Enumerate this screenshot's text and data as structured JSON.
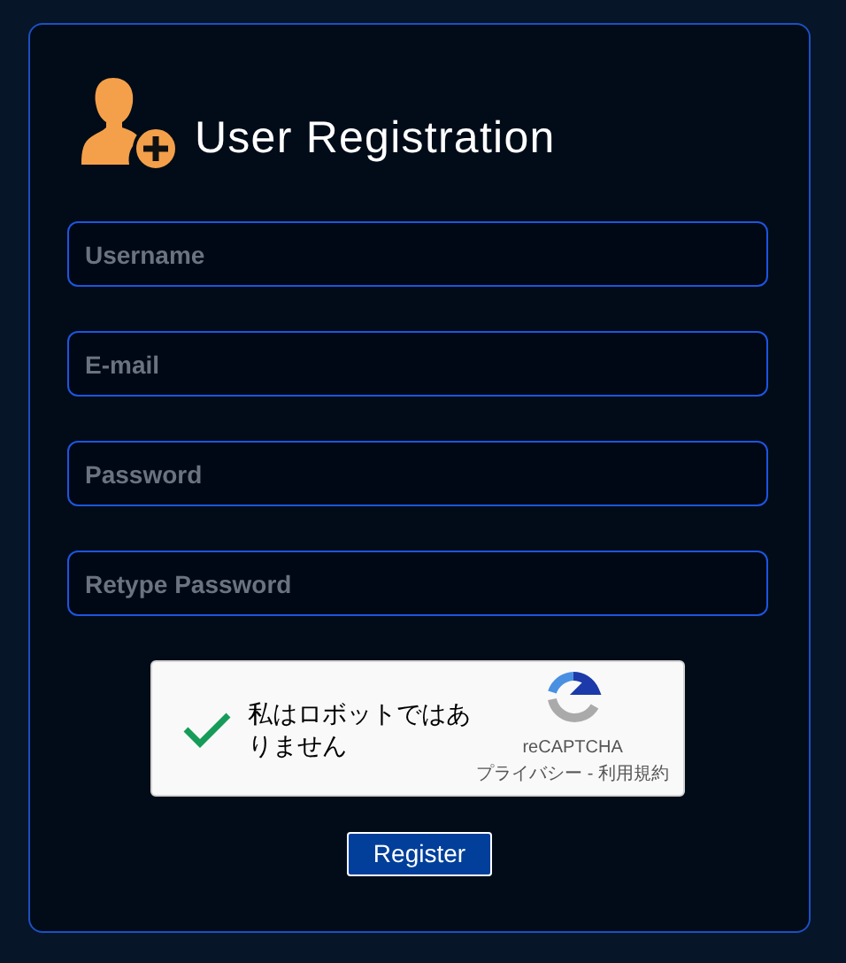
{
  "title": "User Registration",
  "fields": [
    {
      "placeholder": "Username"
    },
    {
      "placeholder": "E-mail"
    },
    {
      "placeholder": "Password"
    },
    {
      "placeholder": "Retype Password"
    }
  ],
  "captcha": {
    "checked": true,
    "label": "私はロボットではありません",
    "brand": "reCAPTCHA",
    "links": "プライバシー - 利用規約"
  },
  "submit": "Register"
}
